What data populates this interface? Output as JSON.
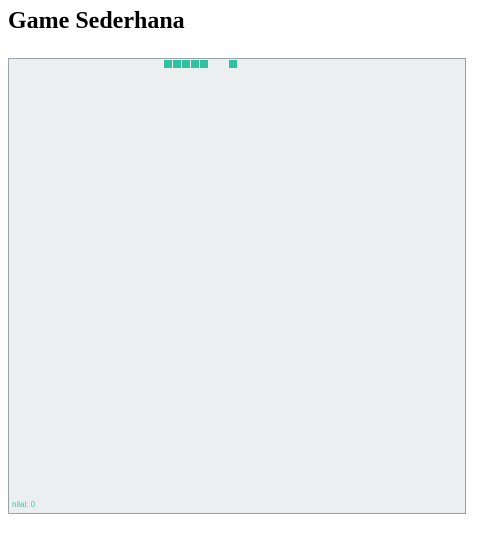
{
  "page": {
    "title": "Game Sederhana"
  },
  "game": {
    "score_text": "nilai: 0",
    "score": 0,
    "snake_length": 5,
    "food_count": 1,
    "colors": {
      "board_background": "#ebeff0",
      "board_border": "#9aa3a8",
      "snake": "#2fc2a0",
      "food": "#2fc2a0",
      "score_text": "#3fc7a8"
    }
  }
}
